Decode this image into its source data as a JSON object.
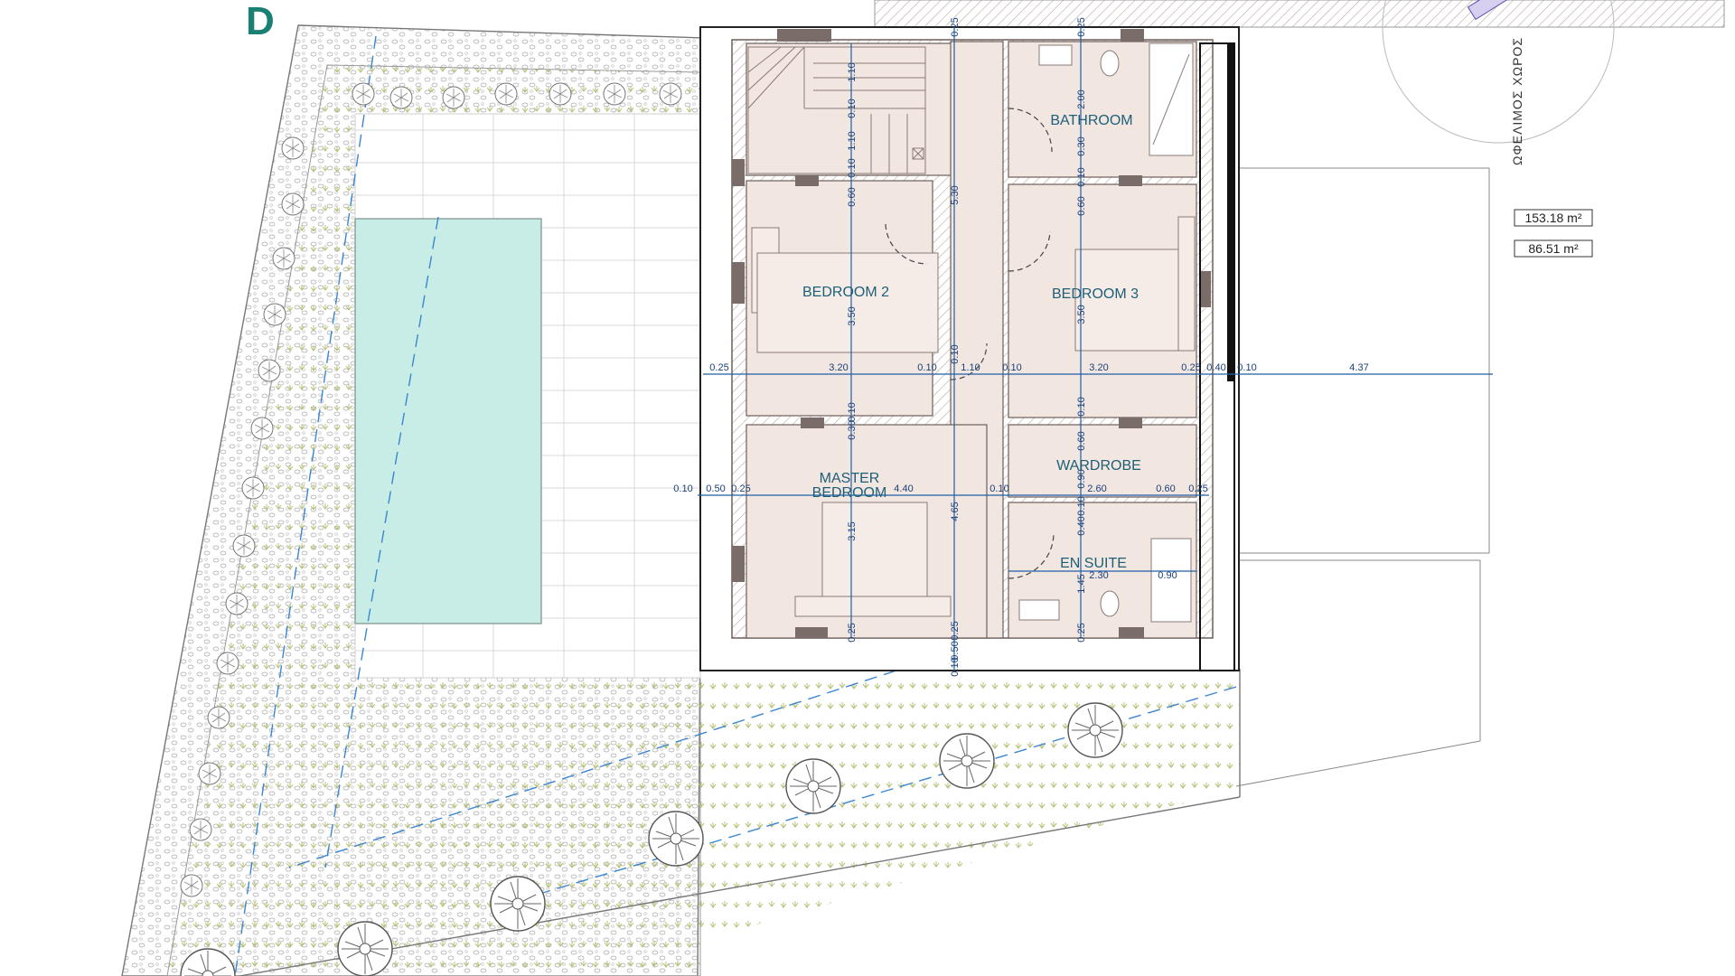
{
  "sheet_letter": "D",
  "rooms": {
    "bathroom": "BATHROOM",
    "bedroom2": "BEDROOM 2",
    "bedroom3": "BEDROOM 3",
    "master_line1": "MASTER",
    "master_line2": "BEDROOM",
    "wardrobe": "WARDROBE",
    "en_suite": "EN SUITE"
  },
  "areas": [
    "153.18 m²",
    "86.51 m²"
  ],
  "side_label": "ΩΦΕΛΙΜΟΣ ΧΩΡΟΣ",
  "dimensions": {
    "row1": [
      "0.25",
      "3.20",
      "0.10",
      "1.10",
      "0.10",
      "3.20",
      "0.25",
      "0.40",
      "0.10",
      "4.37"
    ],
    "row2": [
      "0.10",
      "0.50",
      "0.25",
      "4.40",
      "0.10",
      "2.60",
      "0.60",
      "0.25"
    ],
    "en_suite": [
      "2.30",
      "0.90"
    ],
    "vertical_left": [
      "1.10",
      "0.10",
      "1.10",
      "0.10",
      "0.60",
      "3.50",
      "0.10",
      "0.30",
      "3.15",
      "0.25"
    ],
    "vertical_mid": [
      "0.25",
      "5.30",
      "0.10",
      "4.65",
      "0.25",
      "0.50",
      "0.10"
    ],
    "vertical_right": [
      "0.25",
      "2.00",
      "0.30",
      "0.10",
      "0.60",
      "3.50",
      "0.10",
      "0.60",
      "0.90",
      "0.10",
      "0.40",
      "1.45",
      "0.25"
    ]
  },
  "colors": {
    "room_fill": "#f2e6e1",
    "pool": "#c8ede6",
    "wall": "#8a7570",
    "dim": "#1f5fa8",
    "label": "#1d5f77",
    "grass": "#b8c27a"
  }
}
